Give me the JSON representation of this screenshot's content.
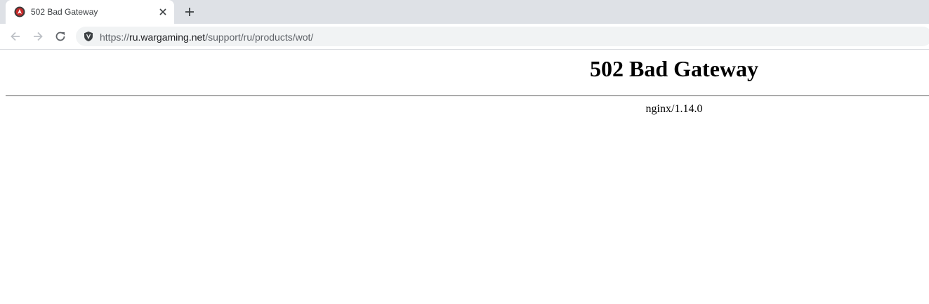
{
  "tab": {
    "title": "502 Bad Gateway",
    "favicon": "wargaming-logo-icon"
  },
  "toolbar": {
    "back_icon": "back-arrow-icon",
    "forward_icon": "forward-arrow-icon",
    "reload_icon": "reload-icon",
    "site_icon": "shield-icon",
    "url_scheme": "https://",
    "url_host": "ru.wargaming.net",
    "url_path": "/support/ru/products/wot/"
  },
  "page": {
    "heading": "502 Bad Gateway",
    "server": "nginx/1.14.0"
  },
  "colors": {
    "tabstrip": "#dee1e6",
    "omnibox": "#f1f3f4",
    "icon": "#5f6368"
  }
}
